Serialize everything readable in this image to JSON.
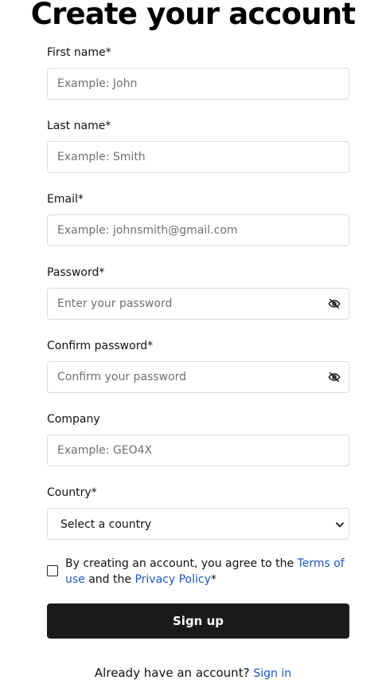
{
  "title": "Create your account",
  "fields": {
    "first_name": {
      "label": "First name*",
      "placeholder": "Example: John"
    },
    "last_name": {
      "label": "Last name*",
      "placeholder": "Example: Smith"
    },
    "email": {
      "label": "Email*",
      "placeholder": "Example: johnsmith@gmail.com"
    },
    "password": {
      "label": "Password*",
      "placeholder": "Enter your password"
    },
    "confirm_password": {
      "label": "Confirm password*",
      "placeholder": "Confirm your password"
    },
    "company": {
      "label": "Company",
      "placeholder": "Example: GEO4X"
    },
    "country": {
      "label": "Country*",
      "selected": "Select a country"
    }
  },
  "agreement": {
    "text_before": "By creating an account, you agree to the ",
    "terms_link": "Terms of use",
    "text_middle": " and the ",
    "privacy_link": "Privacy Policy",
    "text_after": "*"
  },
  "signup_button": "Sign up",
  "footer": {
    "prompt": "Already have an account?",
    "signin_link": "Sign in"
  },
  "colors": {
    "link": "#1a56c8",
    "button_bg": "#1a1a1c",
    "input_border": "#dcdcdc"
  },
  "icons": {
    "password_toggle": "eye-off-icon",
    "select_arrow": "chevron-down-icon"
  }
}
